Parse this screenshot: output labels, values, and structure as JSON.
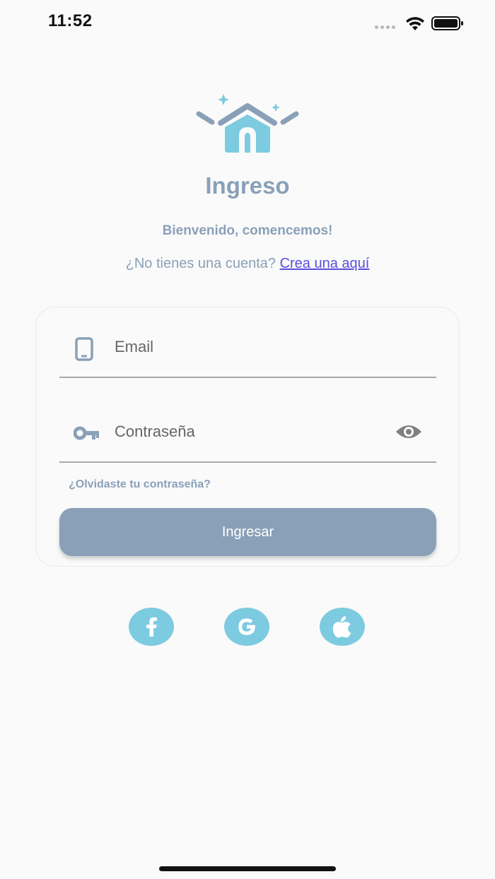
{
  "status_bar": {
    "time": "11:52"
  },
  "header": {
    "title": "Ingreso",
    "welcome": "Bienvenido, comencemos!",
    "signup_prompt": "¿No tienes una cuenta?",
    "signup_link": "Crea una aquí"
  },
  "form": {
    "email_placeholder": "Email",
    "password_placeholder": "Contraseña",
    "forgot_password": "¿Olvidaste tu contraseña?",
    "submit_label": "Ingresar"
  },
  "social": [
    {
      "icon": "facebook-icon"
    },
    {
      "icon": "google-icon"
    },
    {
      "icon": "apple-icon"
    }
  ],
  "colors": {
    "accent": "#89a0b8",
    "logo_blue": "#7ccbe0",
    "link": "#5b4fe0",
    "background": "#fafafa"
  }
}
